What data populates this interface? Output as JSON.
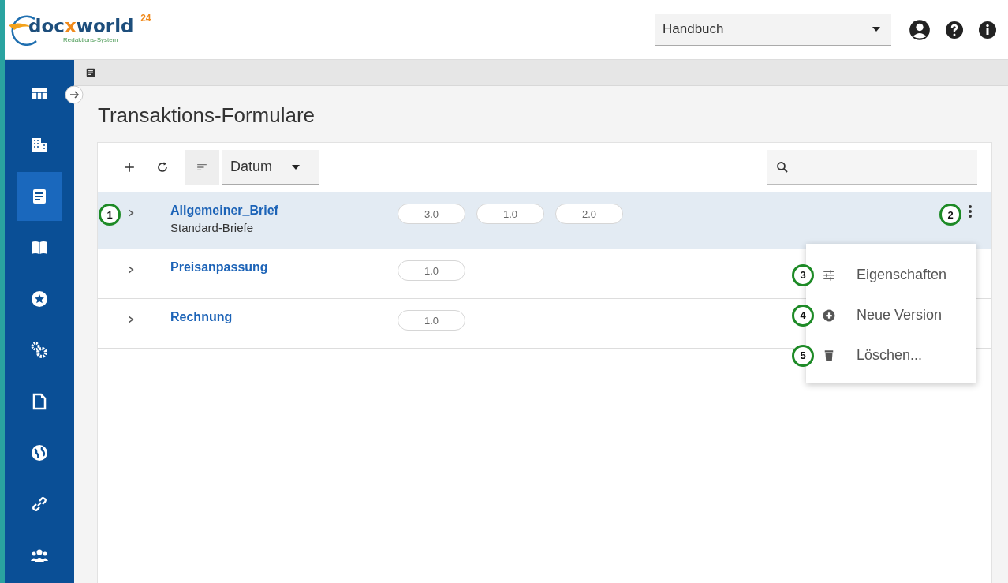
{
  "header": {
    "logo": {
      "parts": [
        "doc",
        "x",
        "world"
      ],
      "superscript": "24",
      "tagline": "Redaktions-System"
    },
    "manual_select": {
      "value": "Handbuch"
    }
  },
  "sidebar": {
    "items": [
      {
        "kind": "dashboard",
        "selected": false
      },
      {
        "kind": "building",
        "selected": false
      },
      {
        "kind": "document",
        "selected": true
      },
      {
        "kind": "book",
        "selected": false
      },
      {
        "kind": "star",
        "selected": false
      },
      {
        "kind": "gears",
        "selected": false
      },
      {
        "kind": "file",
        "selected": false
      },
      {
        "kind": "globe",
        "selected": false
      },
      {
        "kind": "link",
        "selected": false
      },
      {
        "kind": "users",
        "selected": false
      }
    ]
  },
  "page": {
    "title": "Transaktions-Formulare"
  },
  "toolbar": {
    "sort_select": {
      "value": "Datum"
    }
  },
  "rows": [
    {
      "name": "Allgemeiner_Brief",
      "subtitle": "Standard-Briefe",
      "versions": [
        "3.0",
        "1.0",
        "2.0"
      ],
      "selected": true,
      "callout": "1",
      "menu_callout": "2"
    },
    {
      "name": "Preisanpassung",
      "versions": [
        "1.0"
      ],
      "selected": false
    },
    {
      "name": "Rechnung",
      "versions": [
        "1.0"
      ],
      "selected": false
    }
  ],
  "context_menu": {
    "items": [
      {
        "kind": "properties",
        "label": "Eigenschaften",
        "callout": "3"
      },
      {
        "kind": "add",
        "label": "Neue Version",
        "callout": "4"
      },
      {
        "kind": "delete",
        "label": "Löschen...",
        "callout": "5"
      }
    ]
  }
}
